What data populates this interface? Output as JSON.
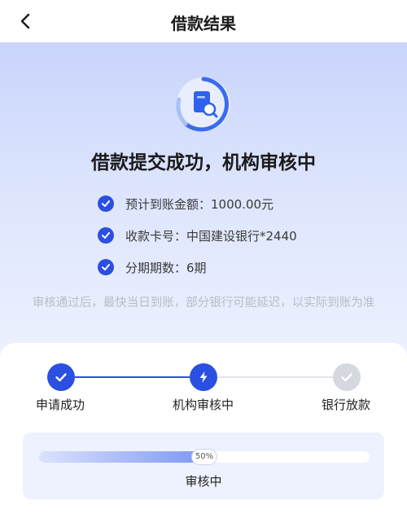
{
  "nav": {
    "title": "借款结果",
    "back_icon": "chevron-left-icon"
  },
  "hero": {
    "icon": "document-search-icon",
    "headline": "借款提交成功，机构审核中",
    "items": [
      {
        "text": "预计到账金额：1000.00元"
      },
      {
        "text": "收款卡号：中国建设银行*2440"
      },
      {
        "text": "分期期数：6期"
      }
    ],
    "notice": "审核通过后，最快当日到账，部分银行可能延迟，以实际到账为准"
  },
  "steps": [
    {
      "label": "申请成功",
      "state": "done",
      "icon": "check-icon"
    },
    {
      "label": "机构审核中",
      "state": "active",
      "icon": "lightning-icon"
    },
    {
      "label": "银行放款",
      "state": "pending",
      "icon": "check-icon"
    }
  ],
  "progress": {
    "percent": 50,
    "label": "50%",
    "status": "审核中"
  },
  "colors": {
    "accent": "#2b4fe0",
    "pending": "#d5d8df",
    "hero_top": "#c9d4fb"
  }
}
